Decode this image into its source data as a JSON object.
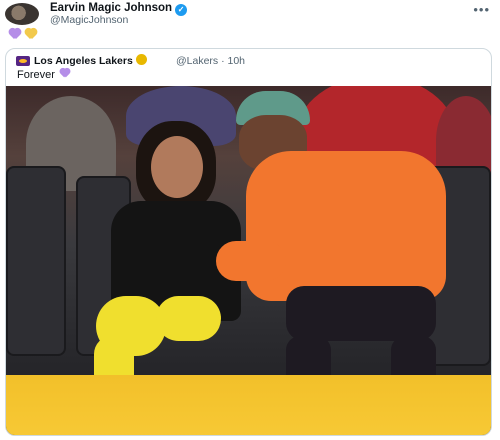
{
  "tweet": {
    "author_name": "Earvin Magic Johnson",
    "author_handle": "@MagicJohnson",
    "verified_icon": "blue-check",
    "text_emojis": [
      "purple-heart",
      "yellow-heart"
    ],
    "colors": {
      "purple_heart": "#b58ee8",
      "yellow_heart": "#f2c94c",
      "verified": "#1d9bf0"
    }
  },
  "quoted_tweet": {
    "account_name": "Los Angeles Lakers",
    "handle_time": "@Lakers · 10h",
    "badge_icon": "gold-verified",
    "text": "Forever",
    "text_emoji": "purple-heart",
    "colors": {
      "brand_purple": "#552583",
      "brand_gold": "#fdb927"
    }
  }
}
